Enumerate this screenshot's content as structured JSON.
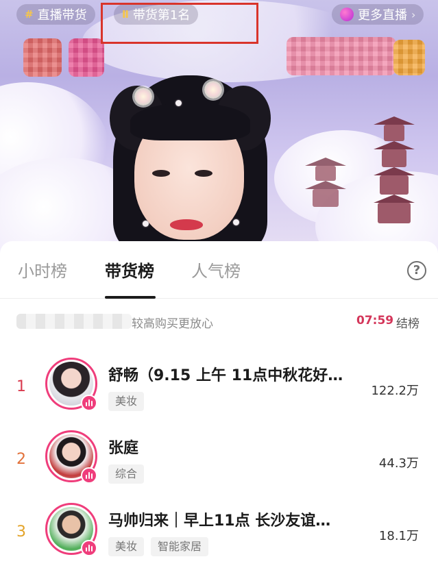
{
  "overlay": {
    "live_shopping_label": "直播带货",
    "rank_label": "带货第1名",
    "more_live_label": "更多直播",
    "more_live_chevron": "›",
    "hash_icon": "#",
    "rank_icon": "Ⅱ"
  },
  "tabs": [
    {
      "label": "小时榜",
      "active": false
    },
    {
      "label": "带货榜",
      "active": true
    },
    {
      "label": "人气榜",
      "active": false
    }
  ],
  "help_icon": "?",
  "notice": {
    "text": "较高购买更放心",
    "countdown": "07:59",
    "countdown_suffix": "结榜"
  },
  "rankings": [
    {
      "rank": "1",
      "name": "舒畅（9.15 上午 11点中秋花好…",
      "tags": [
        "美妆"
      ],
      "sales": "122.2万",
      "rank_color": "#d93a4e"
    },
    {
      "rank": "2",
      "name": "张庭",
      "tags": [
        "综合"
      ],
      "sales": "44.3万",
      "rank_color": "#e2713a"
    },
    {
      "rank": "3",
      "name": "马帅归来｜早上11点 长沙友谊…",
      "tags": [
        "美妆",
        "智能家居"
      ],
      "sales": "18.1万",
      "rank_color": "#e3a328"
    }
  ],
  "colors": {
    "accent_pink": "#ef3d7b",
    "countdown_red": "#d4365a",
    "highlight_box": "#d9342b"
  }
}
